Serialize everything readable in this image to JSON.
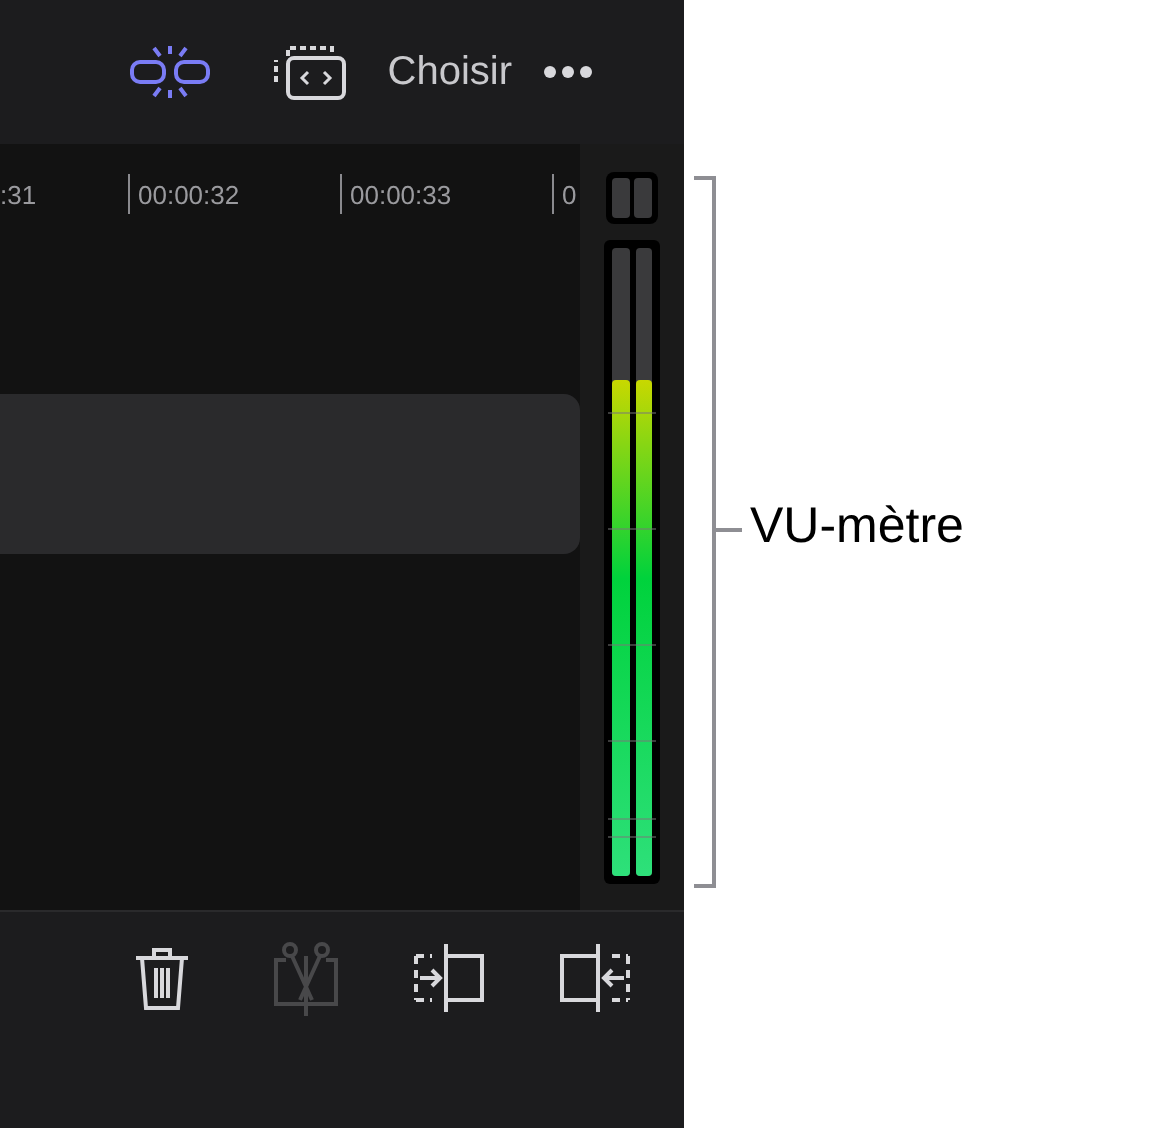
{
  "top_toolbar": [
    {
      "kind": "snap",
      "on": true
    },
    {
      "kind": "overlay",
      "on": false
    },
    {
      "kind": "label",
      "label": "Choisir"
    },
    {
      "kind": "more",
      "on": false
    }
  ],
  "ruler": [
    ":31",
    "00:00:32",
    "00:00:33",
    "0"
  ],
  "meter": {
    "channels": [
      {
        "level": 0.79
      },
      {
        "level": 0.79
      }
    ]
  },
  "bottom_toolbar": [
    {
      "kind": "delete",
      "disabled": false
    },
    {
      "kind": "split",
      "disabled": true
    },
    {
      "kind": "trim-start",
      "disabled": false
    },
    {
      "kind": "trim-end",
      "disabled": false
    }
  ],
  "callout": {
    "label": "VU-mètre"
  }
}
